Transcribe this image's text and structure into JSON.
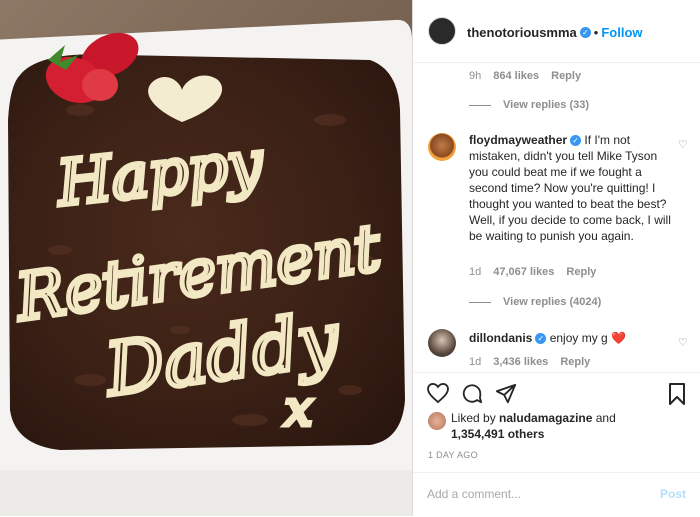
{
  "post": {
    "header": {
      "username": "thenotoriousmma",
      "separator": "•",
      "follow_label": "Follow",
      "verified_icon": "✓"
    },
    "top_meta": {
      "time": "9h",
      "likes": "864 likes",
      "reply": "Reply"
    },
    "top_view_replies": "View replies (33)",
    "comments": [
      {
        "username": "floydmayweather",
        "text": "If I'm not mistaken, didn't you tell Mike Tyson you could beat me if we fought a second time? Now you're quitting! I thought you wanted to beat the best? Well, if you decide to come back, I will be waiting to punish you again.",
        "time": "1d",
        "likes": "47,067 likes",
        "reply": "Reply",
        "view_replies": "View replies (4024)"
      },
      {
        "username": "dillondanis",
        "text": "enjoy my g",
        "emoji": "❤️",
        "time": "1d",
        "likes": "3,436 likes",
        "reply": "Reply"
      }
    ],
    "liked_by": {
      "prefix": "Liked by",
      "user": "naludamagazine",
      "connector": "and",
      "others": "1,354,491 others"
    },
    "timestamp": "1 DAY AGO",
    "add_comment_placeholder": "Add a comment...",
    "post_label": "Post"
  },
  "photo": {
    "cake_text_line1": "Happy",
    "cake_text_line2": "Retirement",
    "cake_text_line3": "Daddy",
    "cake_text_line4": "x"
  },
  "colors": {
    "accent": "#0095f6",
    "verified": "#3897f0",
    "muted": "#8e8e8e",
    "text": "#262626"
  }
}
